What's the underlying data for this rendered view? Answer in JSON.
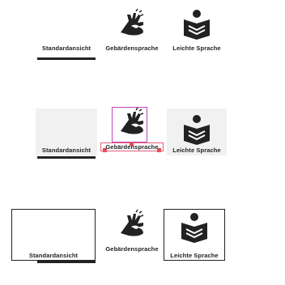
{
  "rows": [
    {
      "items": [
        {
          "label": "Standardansicht",
          "icon": "none"
        },
        {
          "label": "Gebärdensprache",
          "icon": "sign-language-icon"
        },
        {
          "label": "Leichte Sprache",
          "icon": "easy-language-icon"
        }
      ]
    },
    {
      "items": [
        {
          "label": "Standardansicht",
          "icon": "none"
        },
        {
          "label": "Gebärdensprache",
          "icon": "sign-language-icon"
        },
        {
          "label": "Leichte Sprache",
          "icon": "easy-language-icon"
        }
      ]
    },
    {
      "items": [
        {
          "label": "Standardansicht",
          "icon": "none"
        },
        {
          "label": "Gebärdensprache",
          "icon": "sign-language-icon"
        },
        {
          "label": "Leichte Sprache",
          "icon": "easy-language-icon"
        }
      ]
    }
  ],
  "colors": {
    "text": "#222222",
    "hover_bg": "#f1f1f1",
    "selection": "#c044b8",
    "handle": "#e0484e"
  }
}
